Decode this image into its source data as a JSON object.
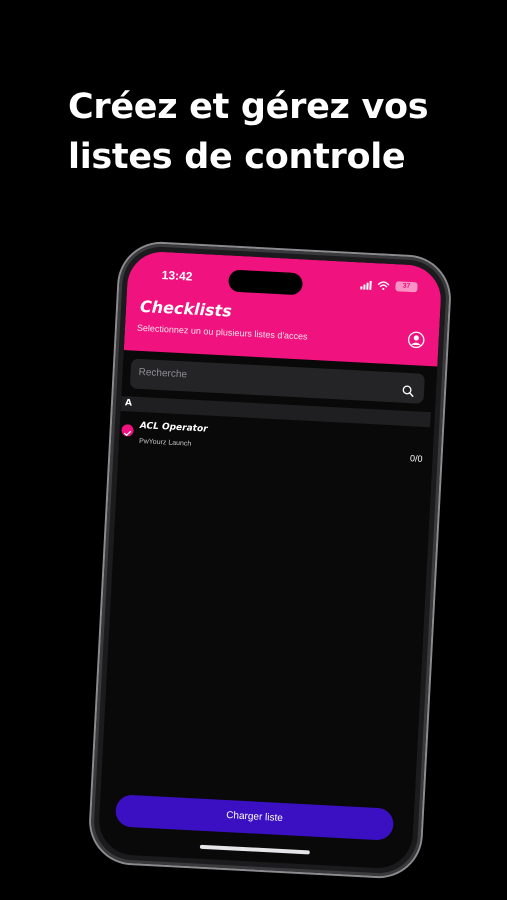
{
  "promo": {
    "headline_line1": "Créez et gérez vos",
    "headline_line2": "listes de controle"
  },
  "statusbar": {
    "time": "13:42",
    "battery": "37"
  },
  "header": {
    "title": "Checklists",
    "subtitle": "Selectionnez un ou plusieurs listes d'acces"
  },
  "search": {
    "placeholder": "Recherche"
  },
  "list": {
    "section_label": "A",
    "items": [
      {
        "title": "ACL Operator",
        "subtitle": "PwYourz Launch",
        "count": "0/0",
        "checked": true
      }
    ]
  },
  "footer": {
    "button_label": "Charger liste"
  },
  "colors": {
    "accent_pink": "#f0127e",
    "button_purple": "#3b0fc2",
    "background": "#000000"
  }
}
